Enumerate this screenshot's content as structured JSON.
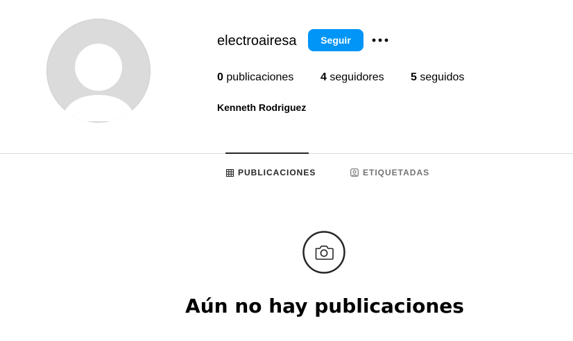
{
  "profile": {
    "username": "electroairesa",
    "follow_label": "Seguir",
    "full_name": "Kenneth Rodriguez",
    "stats": {
      "posts_count": "0",
      "posts_label": "publicaciones",
      "followers_count": "4",
      "followers_label": "seguidores",
      "following_count": "5",
      "following_label": "seguidos"
    }
  },
  "tabs": [
    {
      "label": "PUBLICACIONES",
      "icon": "grid-icon",
      "active": true
    },
    {
      "label": "ETIQUETADAS",
      "icon": "tagged-icon",
      "active": false
    }
  ],
  "empty_state": {
    "icon": "camera-icon",
    "title": "Aún no hay publicaciones"
  },
  "colors": {
    "accent": "#0095f6",
    "divider": "#dbdbdb",
    "avatar_bg": "#dbdbdb",
    "inactive_tab": "#737373"
  }
}
